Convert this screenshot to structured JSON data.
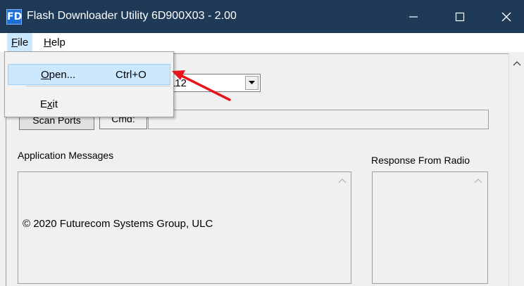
{
  "window": {
    "icon_text": "FD",
    "title": "Flash Downloader Utility 6D900X03 - 2.00",
    "minimize_glyph": "—",
    "maximize_glyph": "☐",
    "close_glyph": "✕"
  },
  "menubar": {
    "file": {
      "label": "File",
      "mnemonic": "F",
      "rest": "ile"
    },
    "help": {
      "label": "Help",
      "mnemonic": "H",
      "rest": "elp"
    }
  },
  "file_menu": {
    "items": [
      {
        "mnemonic": "O",
        "rest": "pen...",
        "shortcut": "Ctrl+O",
        "highlighted": true
      },
      {
        "pre": "E",
        "mnemonic": "x",
        "rest": "it",
        "shortcut": ""
      }
    ]
  },
  "port_combo": {
    "value": "112"
  },
  "buttons": {
    "scan_ports": "Scan Ports",
    "cmd": "Cmd:"
  },
  "labels": {
    "application_messages": "Application Messages",
    "response_from_radio": "Response From Radio"
  },
  "application_messages": {
    "text": "© 2020 Futurecom Systems Group, ULC"
  },
  "colors": {
    "titlebar": "#1f3a56",
    "menu_highlight": "#cce8ff",
    "annotation_arrow": "#e8141c"
  },
  "icons": [
    "app-icon",
    "minimize-icon",
    "maximize-icon",
    "close-icon",
    "dropdown-arrow-icon",
    "scroll-up-arrow-icon"
  ]
}
